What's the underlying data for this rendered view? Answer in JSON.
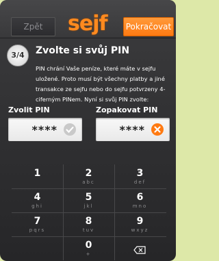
{
  "header": {
    "back_label": "Zpět",
    "logo_text": "sejf",
    "next_label": "Pokračovat"
  },
  "step": {
    "badge": "3/4",
    "title": "Zvolte si svůj PIN",
    "description": "PIN chrání Vaše peníze, které máte v sejfu uložené. Proto musí být všechny platby a jiné transakce ze sejfu nebo do sejfu potvrzeny 4-ciferným PINem. Nyní si svůj PIN zvolte:"
  },
  "pin": {
    "choose_label": "Zvolit PIN",
    "choose_value": "****",
    "choose_status": "check-icon",
    "repeat_label": "Zopakovat PIN",
    "repeat_value": "****",
    "repeat_status": "error-x-icon"
  },
  "keypad": {
    "keys": [
      {
        "num": "1",
        "letters": ""
      },
      {
        "num": "2",
        "letters": "abc"
      },
      {
        "num": "3",
        "letters": "def"
      },
      {
        "num": "4",
        "letters": "ghi"
      },
      {
        "num": "5",
        "letters": "jkl"
      },
      {
        "num": "6",
        "letters": "mno"
      },
      {
        "num": "7",
        "letters": "pqrs"
      },
      {
        "num": "8",
        "letters": "tuv"
      },
      {
        "num": "9",
        "letters": "wxyz"
      },
      {
        "num": "",
        "letters": ""
      },
      {
        "num": "0",
        "letters": "+"
      },
      {
        "num": "",
        "letters": ""
      }
    ]
  },
  "colors": {
    "accent": "#ff7a12",
    "background": "#2e2e30",
    "success": "#9b9b9b",
    "error": "#ff7a12"
  }
}
